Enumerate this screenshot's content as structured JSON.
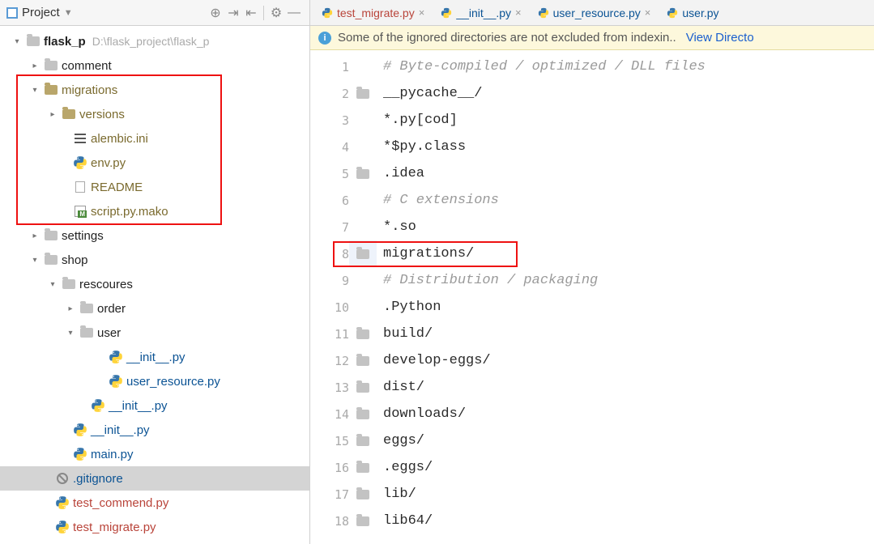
{
  "toolbar": {
    "project_label": "Project"
  },
  "tree": {
    "root": {
      "name": "flask_p",
      "path": "D:\\flask_project\\flask_p"
    },
    "comment": "comment",
    "migrations": {
      "name": "migrations",
      "versions": "versions",
      "alembic": "alembic.ini",
      "env": "env.py",
      "readme": "README",
      "script": "script.py.mako"
    },
    "settings": "settings",
    "shop": {
      "name": "shop",
      "rescoures": "rescoures",
      "order": "order",
      "user": {
        "name": "user",
        "init": "__init__.py",
        "user_resource": "user_resource.py"
      },
      "init1": "__init__.py",
      "init2": "__init__.py",
      "main": "main.py"
    },
    "gitignore": ".gitignore",
    "test_commend": "test_commend.py",
    "test_migrate": "test_migrate.py"
  },
  "tabs": {
    "t1": "test_migrate.py",
    "t2": "__init__.py",
    "t3": "user_resource.py",
    "t4": "user.py"
  },
  "notice": {
    "text": "Some of the ignored directories are not excluded from indexin..",
    "link": "View Directo"
  },
  "code": [
    {
      "n": 1,
      "icon": false,
      "comment": true,
      "t": "# Byte-compiled / optimized / DLL files"
    },
    {
      "n": 2,
      "icon": true,
      "comment": false,
      "t": "__pycache__/"
    },
    {
      "n": 3,
      "icon": false,
      "comment": false,
      "t": "*.py[cod]"
    },
    {
      "n": 4,
      "icon": false,
      "comment": false,
      "t": "*$py.class"
    },
    {
      "n": 5,
      "icon": true,
      "comment": false,
      "t": ".idea"
    },
    {
      "n": 6,
      "icon": false,
      "comment": true,
      "t": "# C extensions"
    },
    {
      "n": 7,
      "icon": false,
      "comment": false,
      "t": "*.so"
    },
    {
      "n": 8,
      "icon": true,
      "comment": false,
      "t": "migrations/",
      "hl": true
    },
    {
      "n": 9,
      "icon": false,
      "comment": true,
      "t": "# Distribution / packaging"
    },
    {
      "n": 10,
      "icon": false,
      "comment": false,
      "t": ".Python"
    },
    {
      "n": 11,
      "icon": true,
      "comment": false,
      "t": "build/"
    },
    {
      "n": 12,
      "icon": true,
      "comment": false,
      "t": "develop-eggs/"
    },
    {
      "n": 13,
      "icon": true,
      "comment": false,
      "t": "dist/"
    },
    {
      "n": 14,
      "icon": true,
      "comment": false,
      "t": "downloads/"
    },
    {
      "n": 15,
      "icon": true,
      "comment": false,
      "t": "eggs/"
    },
    {
      "n": 16,
      "icon": true,
      "comment": false,
      "t": ".eggs/"
    },
    {
      "n": 17,
      "icon": true,
      "comment": false,
      "t": "lib/"
    },
    {
      "n": 18,
      "icon": true,
      "comment": false,
      "t": "lib64/"
    }
  ]
}
